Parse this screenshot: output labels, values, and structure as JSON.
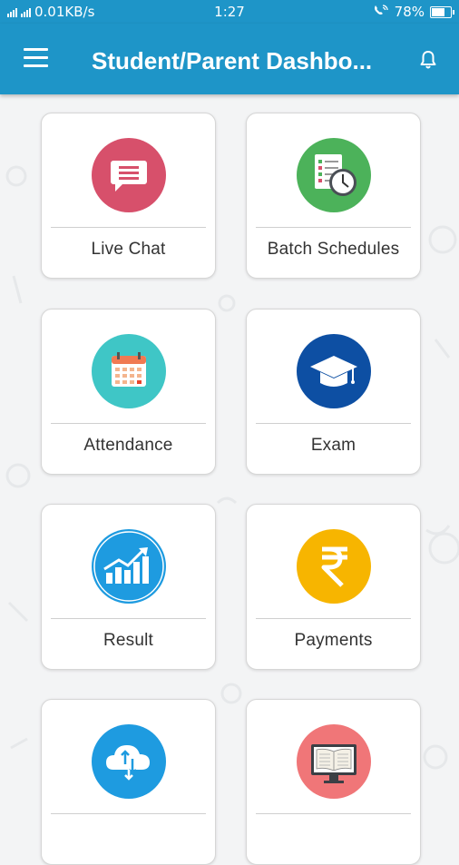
{
  "status_bar": {
    "network_speed": "0.01KB/s",
    "time": "1:27",
    "battery": "78%",
    "battery_level": 0.78
  },
  "app_bar": {
    "title": "Student/Parent Dashbo...",
    "menu_icon": "hamburger-menu-icon",
    "notification_icon": "bell-icon"
  },
  "colors": {
    "primary": "#1e95c8",
    "live_chat": "#d7506b",
    "batch_schedules": "#4cb25a",
    "attendance": "#3fc6c6",
    "exam": "#0d4fa3",
    "result": "#1e9be0",
    "payments": "#f7b500",
    "downloads": "#1e9be0",
    "library": "#f07678"
  },
  "tiles": [
    {
      "label": "Live Chat",
      "icon": "chat-icon"
    },
    {
      "label": "Batch Schedules",
      "icon": "schedule-clock-icon"
    },
    {
      "label": "Attendance",
      "icon": "calendar-icon"
    },
    {
      "label": "Exam",
      "icon": "graduation-cap-icon"
    },
    {
      "label": "Result",
      "icon": "growth-chart-icon"
    },
    {
      "label": "Payments",
      "icon": "rupee-icon"
    },
    {
      "label": "",
      "icon": "cloud-sync-icon"
    },
    {
      "label": "",
      "icon": "ebook-monitor-icon"
    }
  ]
}
